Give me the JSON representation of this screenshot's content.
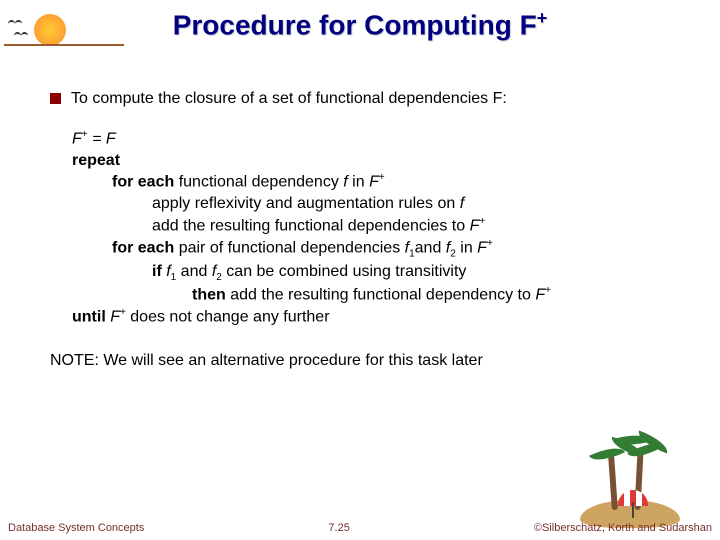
{
  "title_main": "Procedure for Computing F",
  "title_sup": "+",
  "bullet1": "To compute the closure of a set of functional dependencies F:",
  "algo": {
    "l1_a": "F",
    "l1_b": " = F",
    "l2": "repeat",
    "l3_a": "for each",
    "l3_b": " functional dependency ",
    "l3_c": "f",
    "l3_d": " in ",
    "l3_e": "F",
    "l4_a": "apply reflexivity and augmentation rules on ",
    "l4_b": "f",
    "l5_a": "add the resulting functional dependencies to ",
    "l5_b": "F",
    "l6_a": "for each",
    "l6_b": " pair of functional dependencies ",
    "l6_c": "f",
    "l6_d": "and ",
    "l6_e": "f",
    "l6_f": " in ",
    "l6_g": "F",
    "l7_a": "if",
    "l7_b": " f",
    "l7_c": " and ",
    "l7_d": "f",
    "l7_e": " can be combined using transitivity",
    "l8_a": "then",
    "l8_b": " add the resulting functional dependency to ",
    "l8_c": "F",
    "l9_a": "until",
    "l9_b": " F",
    "l9_c": " does not change any further"
  },
  "sub1": "1",
  "sub2": "2",
  "sup_plus": "+",
  "note": "NOTE:  We will see an alternative procedure for this task later",
  "footer_left": "Database System Concepts",
  "footer_center": "7.25",
  "footer_right": "©Silberschatz, Korth and Sudarshan"
}
